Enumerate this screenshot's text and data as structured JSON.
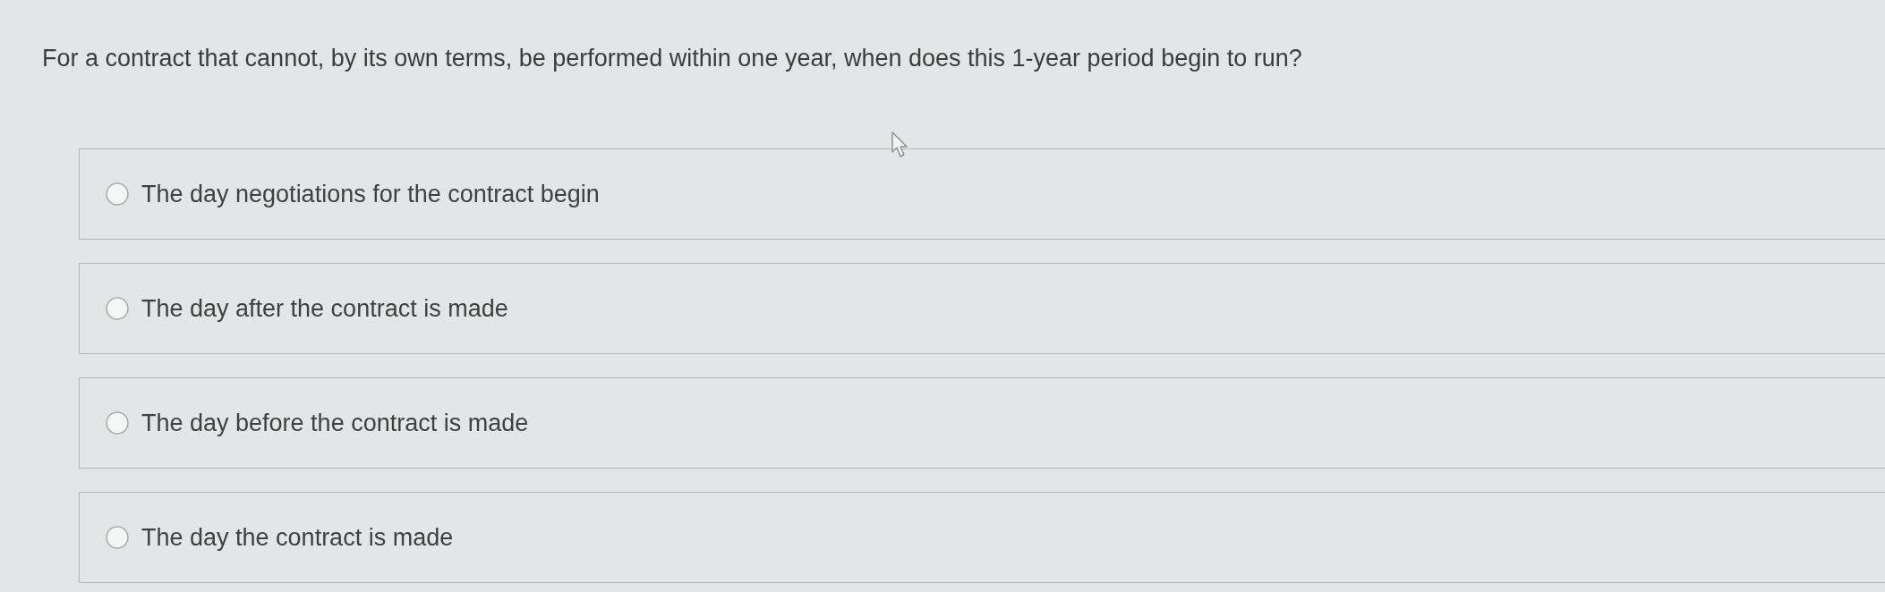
{
  "question": {
    "text": "For a contract that cannot, by its own terms, be performed within one year, when does this 1-year period begin to run?"
  },
  "options": [
    {
      "label": "The day negotiations for the contract begin",
      "selected": false
    },
    {
      "label": "The day after the contract is made",
      "selected": false
    },
    {
      "label": "The day before the contract is made",
      "selected": false
    },
    {
      "label": "The day the contract is made",
      "selected": false
    }
  ]
}
